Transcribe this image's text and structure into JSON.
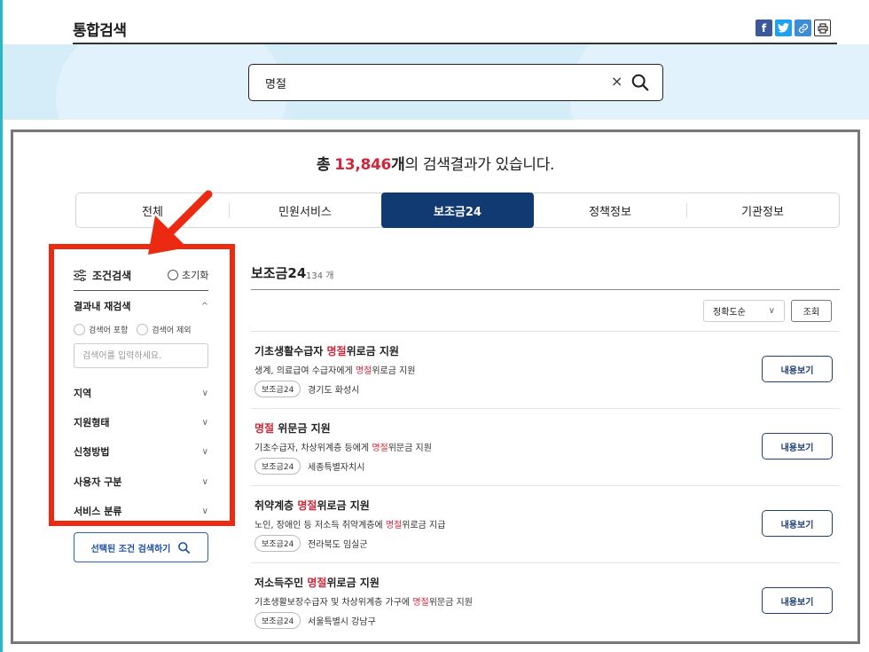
{
  "header": {
    "title": "통합검색",
    "share_icons": [
      "facebook-icon",
      "twitter-icon",
      "link-icon",
      "print-icon"
    ]
  },
  "search": {
    "value": "명절",
    "clear_glyph": "×"
  },
  "summary": {
    "prefix": "총",
    "count": "13,846",
    "unit": "개",
    "suffix": "의 검색결과가 있습니다."
  },
  "tabs": [
    {
      "label": "전체"
    },
    {
      "label": "민원서비스"
    },
    {
      "label": "보조금24",
      "active": true
    },
    {
      "label": "정책정보"
    },
    {
      "label": "기관정보"
    }
  ],
  "filter": {
    "title": "조건검색",
    "reset": "초기화",
    "refine": "결과내 재검색",
    "refine_chevron": "^",
    "include": "검색어 포함",
    "exclude": "검색어 제외",
    "keyword_placeholder": "검색어를 입력하세요.",
    "groups": [
      "지역",
      "지원형태",
      "신청방법",
      "사용자 구분",
      "서비스 분류"
    ],
    "apply": "선택된 조건 검색하기"
  },
  "results": {
    "title": "보조금24",
    "count": "134 개",
    "sort": "정확도순",
    "query_btn": "조회",
    "more_label": "내용보기",
    "items": [
      {
        "t_pre": "기초생활수급자 ",
        "t_hl": "명절",
        "t_post": "위로금 지원",
        "d_pre": "생계, 의료급여 수급자에게 ",
        "d_hl": "명절",
        "d_post": "위로금 지원",
        "tag": "보조금24",
        "region": "경기도 화성시"
      },
      {
        "t_pre": "",
        "t_hl": "명절",
        "t_post": " 위문금 지원",
        "d_pre": "기초수급자, 차상위계층 등에게 ",
        "d_hl": "명절",
        "d_post": "위문금 지원",
        "tag": "보조금24",
        "region": "세종특별자치시"
      },
      {
        "t_pre": "취약계층 ",
        "t_hl": "명절",
        "t_post": "위로금 지원",
        "d_pre": "노인, 장애인 등 저소득 취약계층에 ",
        "d_hl": "명절",
        "d_post": "위로금 지급",
        "tag": "보조금24",
        "region": "전라북도 임실군"
      },
      {
        "t_pre": "저소득주민 ",
        "t_hl": "명절",
        "t_post": "위로금 지원",
        "d_pre": "기초생활보장수급자 및 차상위계층 가구에 ",
        "d_hl": "명절",
        "d_post": "위문금 지원",
        "tag": "보조금24",
        "region": "서울특별시 강남구"
      }
    ]
  },
  "colors": {
    "accent_navy": "#123a72",
    "highlight_red": "#d0283a",
    "annotation_red": "#ec2a12",
    "band_blue": "#d5ecf9"
  }
}
